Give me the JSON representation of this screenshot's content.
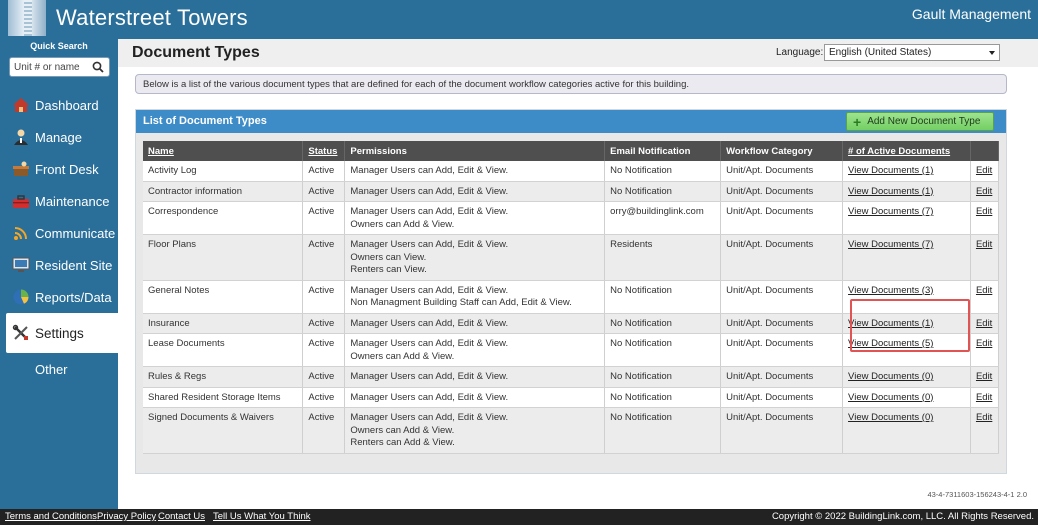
{
  "header": {
    "title": "Waterstreet Towers",
    "company": "Gault Management"
  },
  "sidebar": {
    "quick_search_label": "Quick Search",
    "quick_search_placeholder": "Unit # or name",
    "items": [
      {
        "label": "Dashboard",
        "icon": "house-icon"
      },
      {
        "label": "Manage",
        "icon": "person-icon"
      },
      {
        "label": "Front Desk",
        "icon": "desk-icon"
      },
      {
        "label": "Maintenance",
        "icon": "toolbox-icon"
      },
      {
        "label": "Communicate",
        "icon": "broadcast-icon"
      },
      {
        "label": "Resident Site",
        "icon": "monitor-icon"
      },
      {
        "label": "Reports/Data",
        "icon": "pie-chart-icon"
      },
      {
        "label": "Settings",
        "icon": "tools-icon",
        "active": true
      },
      {
        "label": "Other"
      }
    ]
  },
  "page": {
    "title": "Document Types",
    "language_label": "Language:",
    "language_value": "English (United States)",
    "info": "Below is a list of the various document types that are defined for each of the document workflow categories active for this building."
  },
  "panel": {
    "title": "List of Document Types",
    "add_button": "Add New Document Type",
    "columns": [
      "Name",
      "Status",
      "Permissions",
      "Email Notification",
      "Workflow Category",
      "# of Active Documents",
      ""
    ],
    "rows": [
      {
        "name": "Activity Log",
        "status": "Active",
        "permissions": [
          "Manager Users can Add, Edit & View."
        ],
        "email": "No Notification",
        "category": "Unit/Apt. Documents",
        "docs": "View Documents (1)",
        "edit": "Edit"
      },
      {
        "name": "Contractor information",
        "status": "Active",
        "permissions": [
          "Manager Users can Add, Edit & View."
        ],
        "email": "No Notification",
        "category": "Unit/Apt. Documents",
        "docs": "View Documents (1)",
        "edit": "Edit"
      },
      {
        "name": "Correspondence",
        "status": "Active",
        "permissions": [
          "Manager Users can Add, Edit & View.",
          "Owners can Add & View."
        ],
        "email": "orry@buildinglink.com",
        "category": "Unit/Apt. Documents",
        "docs": "View Documents (7)",
        "edit": "Edit"
      },
      {
        "name": "Floor Plans",
        "status": "Active",
        "permissions": [
          "Manager Users can Add, Edit & View.",
          "Owners can View.",
          "Renters can View."
        ],
        "email": "Residents",
        "category": "Unit/Apt. Documents",
        "docs": "View Documents (7)",
        "edit": "Edit"
      },
      {
        "name": "General Notes",
        "status": "Active",
        "permissions": [
          "Manager Users can Add, Edit & View.",
          "Non Managment Building Staff can Add, Edit & View."
        ],
        "email": "No Notification",
        "category": "Unit/Apt. Documents",
        "docs": "View Documents (3)",
        "edit": "Edit"
      },
      {
        "name": "Insurance",
        "status": "Active",
        "permissions": [
          "Manager Users can Add, Edit & View."
        ],
        "email": "No Notification",
        "category": "Unit/Apt. Documents",
        "docs": "View Documents (1)",
        "edit": "Edit"
      },
      {
        "name": "Lease Documents",
        "status": "Active",
        "permissions": [
          "Manager Users can Add, Edit & View.",
          "Owners can Add & View."
        ],
        "email": "No Notification",
        "category": "Unit/Apt. Documents",
        "docs": "View Documents (5)",
        "edit": "Edit"
      },
      {
        "name": "Rules & Regs",
        "status": "Active",
        "permissions": [
          "Manager Users can Add, Edit & View."
        ],
        "email": "No Notification",
        "category": "Unit/Apt. Documents",
        "docs": "View Documents (0)",
        "edit": "Edit"
      },
      {
        "name": "Shared Resident Storage Items",
        "status": "Active",
        "permissions": [
          "Manager Users can Add, Edit & View."
        ],
        "email": "No Notification",
        "category": "Unit/Apt. Documents",
        "docs": "View Documents (0)",
        "edit": "Edit"
      },
      {
        "name": "Signed Documents & Waivers",
        "status": "Active",
        "permissions": [
          "Manager Users can Add, Edit & View.",
          "Owners can Add & View.",
          "Renters can Add & View."
        ],
        "email": "No Notification",
        "category": "Unit/Apt. Documents",
        "docs": "View Documents (0)",
        "edit": "Edit"
      }
    ]
  },
  "version": "43-4-7311603-156243-4-1 2.0",
  "footer": {
    "links": [
      "Terms and Conditions",
      "Privacy Policy",
      "Contact Us",
      "Tell Us What You Think"
    ],
    "copyright": "Copyright © 2022 BuildingLink.com, LLC.  All Rights Reserved."
  },
  "colors": {
    "brand": "#2a6f9a",
    "panel_header": "#3d8cc8",
    "add_button": "#73cf63",
    "highlight": "#e05454"
  }
}
